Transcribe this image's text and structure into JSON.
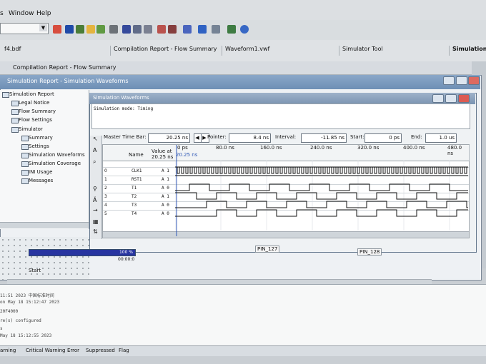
{
  "menu": {
    "items": [
      {
        "label": "s"
      },
      {
        "label": "Window"
      },
      {
        "label": "Help"
      }
    ]
  },
  "toolbar": {
    "project_box": {
      "value": ""
    }
  },
  "tabs": [
    {
      "label": "f4.bdf"
    },
    {
      "label": "Compilation Report - Flow Summary"
    },
    {
      "label": "Waveform1.vwf"
    },
    {
      "label": "Simulator Tool"
    },
    {
      "label": "Simulation"
    }
  ],
  "compilation_report_title": "Compilation Report - Flow Summary",
  "report_window": {
    "title": "Simulation Report - Simulation Waveforms",
    "tree": [
      {
        "label": "Simulation Report"
      },
      {
        "label": "Legal Notice"
      },
      {
        "label": "Flow Summary"
      },
      {
        "label": "Flow Settings"
      },
      {
        "label": "Simulator"
      },
      {
        "label": "Summary"
      },
      {
        "label": "Settings"
      },
      {
        "label": "Simulation Waveforms"
      },
      {
        "label": "Simulation Coverage"
      },
      {
        "label": "INI Usage"
      },
      {
        "label": "Messages"
      }
    ]
  },
  "simulation_window": {
    "title": "Simulation Waveforms",
    "mode": "Simulation mode: Timing",
    "master_time_bar_label": "Master Time Bar:",
    "master_time_bar": "20.25 ns",
    "pointer_label": "Pointer:",
    "pointer": "8.4 ns",
    "interval_label": "Interval:",
    "interval": "-11.85 ns",
    "start_label": "Start:",
    "start": "0 ps",
    "end_label": "End:",
    "end": "1.0 us",
    "timeline": [
      "0 ps",
      "80.0 ns",
      "160.0 ns",
      "240.0 ns",
      "320.0 ns",
      "400.0 ns",
      "480.0 ns"
    ],
    "column_headers": {
      "name": "Name",
      "value": "Value at\n20.25 ns"
    },
    "time_cursor_label": "20.25 ns",
    "rows": [
      {
        "num": "0",
        "name": "CLK1",
        "value": "A 1"
      },
      {
        "num": "1",
        "name": "RST1",
        "value": "A 1"
      },
      {
        "num": "2",
        "name": "T1",
        "value": "A 0"
      },
      {
        "num": "3",
        "name": "T2",
        "value": "A 1"
      },
      {
        "num": "4",
        "name": "T3",
        "value": "A 0"
      },
      {
        "num": "5",
        "name": "T4",
        "value": "A 0"
      }
    ]
  },
  "pins": [
    {
      "label": "PIN_127"
    },
    {
      "label": "PIN_128"
    }
  ],
  "processing_panel": {
    "progress_text": "100 %",
    "progress": 100,
    "elapsed": "00:00:0",
    "start_button": "Start"
  },
  "console": {
    "lines": [
      "11:51 2023 中国标准时间",
      "on May 18 15:12:47 2023",
      "",
      "20F4000",
      "re(s) configured",
      "s",
      " May 18 15:12:55 2023"
    ]
  },
  "bottom_tabs": [
    {
      "label": "arning"
    },
    {
      "label": "Critical Warning"
    },
    {
      "label": "Error"
    },
    {
      "label": "Suppressed"
    },
    {
      "label": "Flag"
    }
  ],
  "colors": {
    "title_blue": "#7b94b2",
    "progress_blue": "#2734a0",
    "waveform_black": "#111111"
  }
}
